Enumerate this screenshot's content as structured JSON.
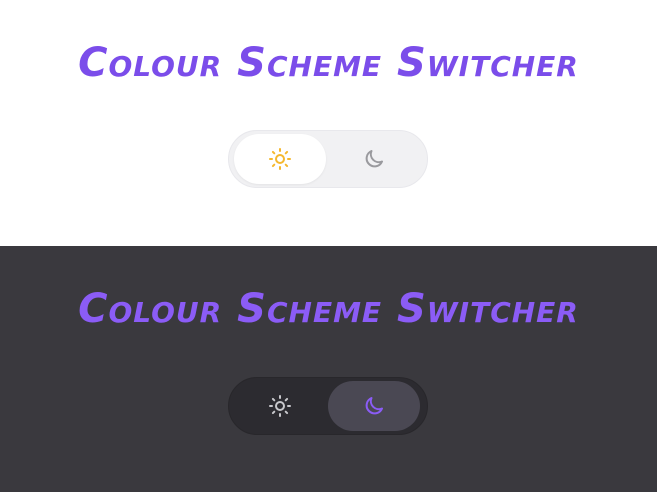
{
  "colors": {
    "accent": "#7b4dea",
    "sun_active": "#f5b82e",
    "moon_inactive": "#9a9a9e",
    "sun_inactive": "#c8c8cc",
    "moon_active": "#8b5cf6",
    "light_bg": "#ffffff",
    "dark_bg": "#3a393e"
  },
  "light_panel": {
    "title": "Colour Scheme Switcher",
    "switch": {
      "selected": "light",
      "options": [
        {
          "value": "light",
          "icon": "sun-icon"
        },
        {
          "value": "dark",
          "icon": "moon-icon"
        }
      ]
    }
  },
  "dark_panel": {
    "title": "Colour Scheme Switcher",
    "switch": {
      "selected": "dark",
      "options": [
        {
          "value": "light",
          "icon": "sun-icon"
        },
        {
          "value": "dark",
          "icon": "moon-icon"
        }
      ]
    }
  }
}
